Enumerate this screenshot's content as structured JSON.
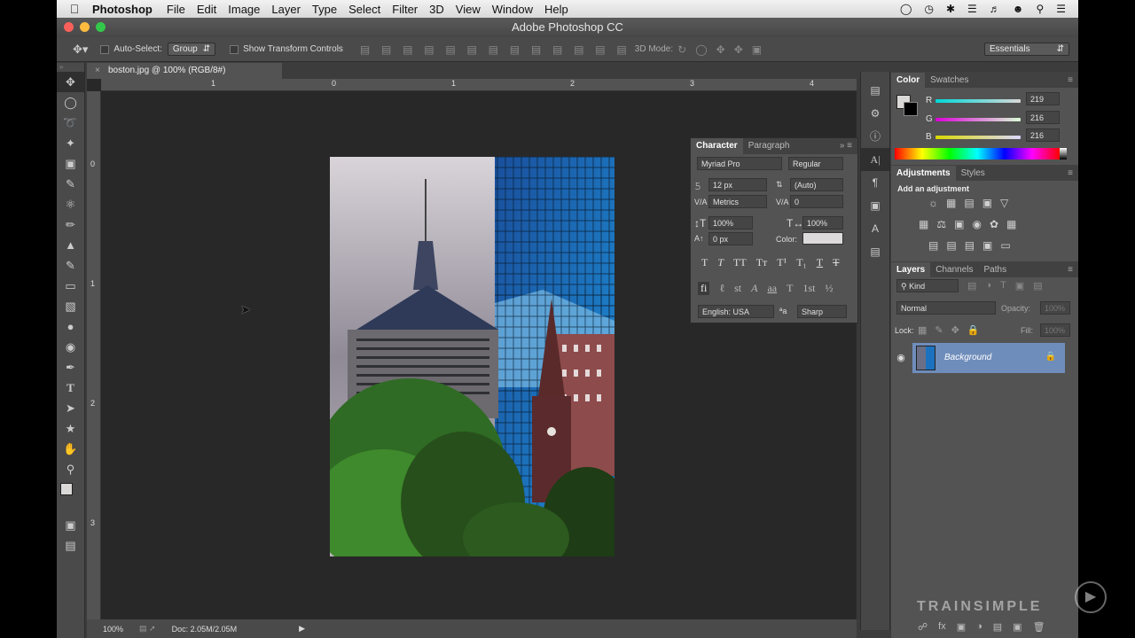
{
  "menubar": {
    "app": "Photoshop",
    "items": [
      "File",
      "Edit",
      "Image",
      "Layer",
      "Type",
      "Select",
      "Filter",
      "3D",
      "View",
      "Window",
      "Help"
    ]
  },
  "window": {
    "title": "Adobe Photoshop CC"
  },
  "options": {
    "auto_select_label": "Auto-Select:",
    "auto_select_value": "Group",
    "transform_label": "Show Transform Controls",
    "mode_3d_label": "3D Mode:",
    "workspace": "Essentials"
  },
  "document": {
    "tab_title": "boston.jpg @ 100% (RGB/8#)",
    "ruler_h": [
      "1",
      "0",
      "1",
      "2",
      "3",
      "4"
    ],
    "ruler_v": [
      "0",
      "1",
      "2",
      "3"
    ],
    "zoom": "100%",
    "doc_size": "Doc: 2.05M/2.05M"
  },
  "character": {
    "tab_character": "Character",
    "tab_paragraph": "Paragraph",
    "font_family": "Myriad Pro",
    "font_style": "Regular",
    "font_size": "12 px",
    "leading": "(Auto)",
    "kerning": "Metrics",
    "tracking": "0",
    "vertical_scale": "100%",
    "horizontal_scale": "100%",
    "baseline_shift": "0 px",
    "color_label": "Color:",
    "language": "English: USA",
    "antialias": "Sharp",
    "aa_label": "ªa"
  },
  "color_panel": {
    "tab_color": "Color",
    "tab_swatches": "Swatches",
    "r_label": "R",
    "r_value": "219",
    "g_label": "G",
    "g_value": "216",
    "b_label": "B",
    "b_value": "216"
  },
  "adjustments": {
    "tab_adjustments": "Adjustments",
    "tab_styles": "Styles",
    "prompt": "Add an adjustment"
  },
  "layers": {
    "tab_layers": "Layers",
    "tab_channels": "Channels",
    "tab_paths": "Paths",
    "filter_kind": "Kind",
    "blend_mode": "Normal",
    "opacity_label": "Opacity:",
    "opacity_value": "100%",
    "lock_label": "Lock:",
    "fill_label": "Fill:",
    "fill_value": "100%",
    "layer_name": "Background"
  },
  "watermark": "TRAINSIMPLE",
  "colors": {
    "accent": "#6f8dbb",
    "panel": "#535353",
    "canvas": "#282828"
  }
}
